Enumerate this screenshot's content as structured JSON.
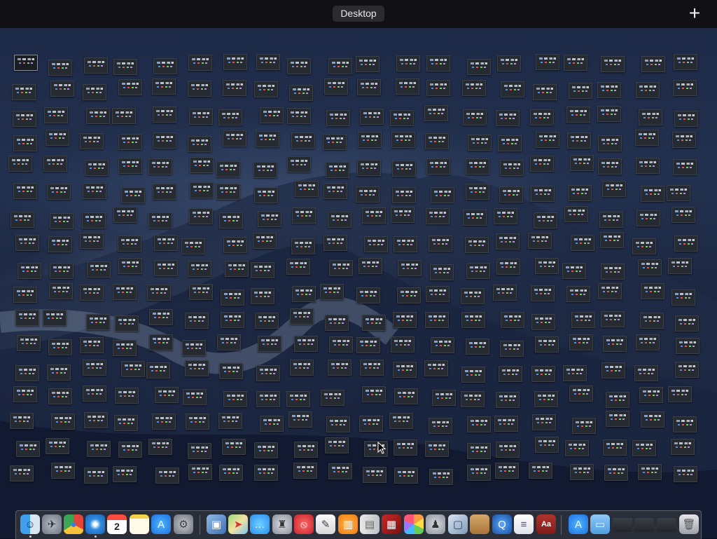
{
  "topbar": {
    "desktop_label": "Desktop",
    "add_label": "+"
  },
  "desktop": {
    "window_count": 402,
    "selected_index": 0
  },
  "dock": {
    "apps": [
      {
        "name": "Finder",
        "icon": "finder-icon",
        "running": true
      },
      {
        "name": "Launchpad",
        "icon": "launchpad-icon",
        "running": false
      },
      {
        "name": "Google Chrome",
        "icon": "chrome-icon",
        "running": false
      },
      {
        "name": "Safari",
        "icon": "safari-icon",
        "running": true
      },
      {
        "name": "Calendar",
        "icon": "calendar-icon",
        "running": false,
        "badge_text": "2"
      },
      {
        "name": "Notes",
        "icon": "notes-icon",
        "running": false
      },
      {
        "name": "App Store",
        "icon": "app-store-icon",
        "running": false
      },
      {
        "name": "System Preferences",
        "icon": "system-preferences-icon",
        "running": false
      },
      {
        "name": "Preview",
        "icon": "preview-icon",
        "running": false
      },
      {
        "name": "Maps",
        "icon": "maps-icon",
        "running": false
      },
      {
        "name": "Messages",
        "icon": "messages-icon",
        "running": false
      },
      {
        "name": "Automator",
        "icon": "automator-icon",
        "running": false
      },
      {
        "name": "No Entry",
        "icon": "no-entry-icon",
        "running": false
      },
      {
        "name": "TextEdit",
        "icon": "textedit-icon",
        "running": false
      },
      {
        "name": "Books",
        "icon": "books-icon",
        "running": false
      },
      {
        "name": "Notebook",
        "icon": "notebook-icon",
        "running": false
      },
      {
        "name": "Photo Booth",
        "icon": "photo-booth-icon",
        "running": false
      },
      {
        "name": "Photos",
        "icon": "photos-icon",
        "running": false
      },
      {
        "name": "Archive Utility",
        "icon": "archive-utility-icon",
        "running": false
      },
      {
        "name": "Image Capture",
        "icon": "image-capture-icon",
        "running": false
      },
      {
        "name": "Notepad",
        "icon": "notepad-icon",
        "running": false
      },
      {
        "name": "QuickTime Player",
        "icon": "quicktime-icon",
        "running": false
      },
      {
        "name": "Script Editor",
        "icon": "script-editor-icon",
        "running": false
      },
      {
        "name": "Dictionary",
        "icon": "dictionary-icon",
        "running": false,
        "badge_text": "Aa"
      },
      {
        "name": "App Store Folder",
        "icon": "app-store-icon",
        "running": false
      },
      {
        "name": "Folder",
        "icon": "folder-icon",
        "running": false
      },
      {
        "name": "Window 1",
        "icon": "window-icon",
        "running": false
      },
      {
        "name": "Window 2",
        "icon": "window-icon",
        "running": false
      },
      {
        "name": "Window 3",
        "icon": "window-icon",
        "running": false
      },
      {
        "name": "Trash",
        "icon": "trash-icon",
        "running": false
      }
    ]
  },
  "colors": {
    "topbar_bg": "#111114",
    "title_pill_bg": "#2c2c30",
    "thumb_bg": "#262a31",
    "dock_bg": "#30343c"
  }
}
